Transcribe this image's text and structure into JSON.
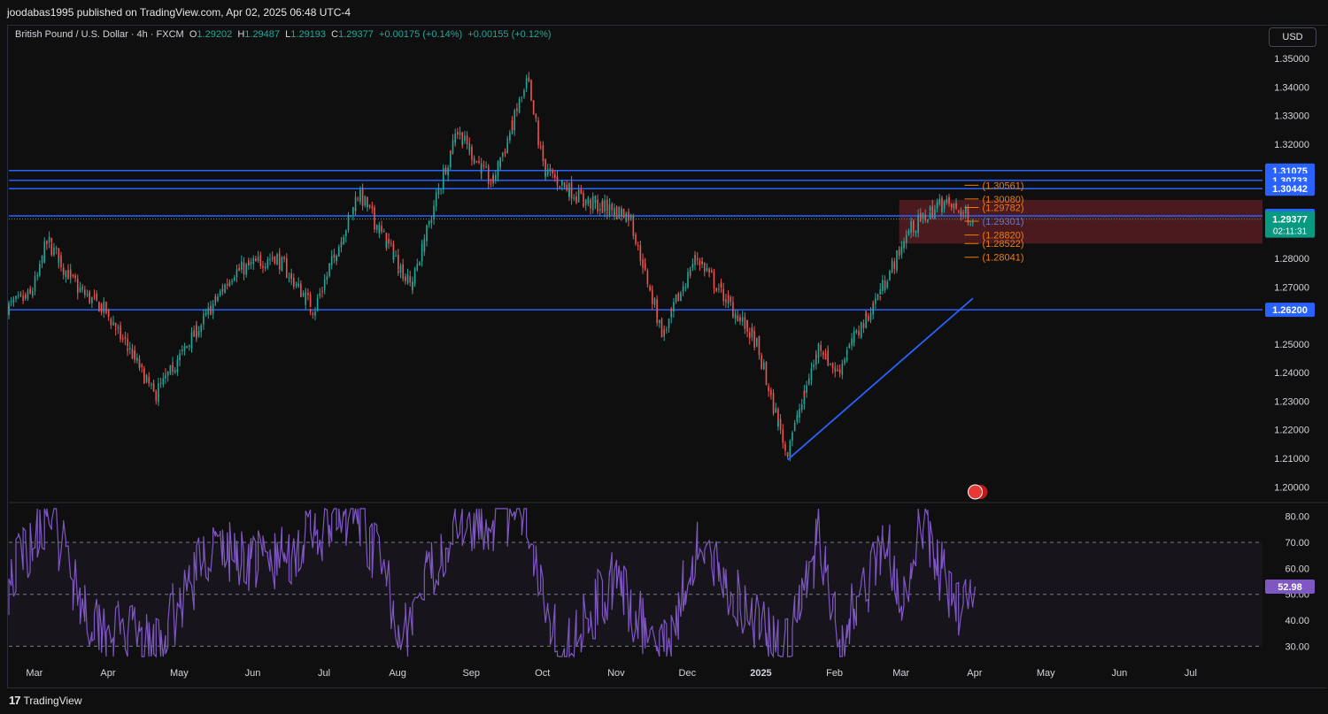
{
  "header": {
    "published_by": "joodabas1995 published on TradingView.com, Apr 02, 2025 06:48 UTC-4"
  },
  "legend": {
    "symbol": "British Pound / U.S. Dollar · 4h · FXCM",
    "o_label": "O",
    "o_value": "1.29202",
    "h_label": "H",
    "h_value": "1.29487",
    "l_label": "L",
    "l_value": "1.29193",
    "c_label": "C",
    "c_value": "1.29377",
    "change1": "+0.00175 (+0.14%)",
    "change2": "+0.00155 (+0.12%)"
  },
  "currency_button": "USD",
  "footer": {
    "brand": "TradingView",
    "logo_glyph": "17"
  },
  "colors": {
    "background": "#0f0f0f",
    "up": "#26a69a",
    "down": "#ef5350",
    "level_line": "#2962ff",
    "rsi_line": "#7e57c2",
    "zone": "#5a1d22",
    "fib": "#f57c00"
  },
  "chart_data": [
    {
      "type": "candlestick",
      "symbol": "GBPUSD",
      "timeframe": "4h",
      "yaxis_ticks": [
        "1.35000",
        "1.34000",
        "1.33000",
        "1.32000",
        "1.28000",
        "1.27000",
        "1.25000",
        "1.24000",
        "1.23000",
        "1.22000",
        "1.21000",
        "1.20000"
      ],
      "ylim": [
        1.197,
        1.3525
      ],
      "x_ticks": [
        "Mar",
        "Apr",
        "May",
        "Jun",
        "Jul",
        "Aug",
        "Sep",
        "Oct",
        "Nov",
        "Dec",
        "2025",
        "Feb",
        "Mar",
        "Apr",
        "May",
        "Jun",
        "Jul"
      ],
      "price_path": [
        {
          "date": "2024-02-20",
          "close": 1.263
        },
        {
          "date": "2024-03-01",
          "close": 1.267
        },
        {
          "date": "2024-03-08",
          "close": 1.286
        },
        {
          "date": "2024-03-20",
          "close": 1.27
        },
        {
          "date": "2024-04-01",
          "close": 1.262
        },
        {
          "date": "2024-04-12",
          "close": 1.247
        },
        {
          "date": "2024-04-22",
          "close": 1.232
        },
        {
          "date": "2024-05-10",
          "close": 1.255
        },
        {
          "date": "2024-05-25",
          "close": 1.275
        },
        {
          "date": "2024-06-12",
          "close": 1.281
        },
        {
          "date": "2024-06-28",
          "close": 1.262
        },
        {
          "date": "2024-07-17",
          "close": 1.303
        },
        {
          "date": "2024-08-08",
          "close": 1.27
        },
        {
          "date": "2024-08-27",
          "close": 1.325
        },
        {
          "date": "2024-09-11",
          "close": 1.306
        },
        {
          "date": "2024-09-26",
          "close": 1.342
        },
        {
          "date": "2024-10-03",
          "close": 1.311
        },
        {
          "date": "2024-10-20",
          "close": 1.3
        },
        {
          "date": "2024-11-08",
          "close": 1.295
        },
        {
          "date": "2024-11-22",
          "close": 1.253
        },
        {
          "date": "2024-12-06",
          "close": 1.281
        },
        {
          "date": "2024-12-31",
          "close": 1.251
        },
        {
          "date": "2025-01-13",
          "close": 1.212
        },
        {
          "date": "2025-01-27",
          "close": 1.25
        },
        {
          "date": "2025-02-03",
          "close": 1.24
        },
        {
          "date": "2025-02-20",
          "close": 1.266
        },
        {
          "date": "2025-03-06",
          "close": 1.29
        },
        {
          "date": "2025-03-20",
          "close": 1.3
        },
        {
          "date": "2025-04-02",
          "close": 1.29377
        }
      ],
      "horizontal_levels": [
        {
          "price": 1.31075,
          "label": "1.31075"
        },
        {
          "price": 1.30733,
          "label": "1.30733"
        },
        {
          "price": 1.30442,
          "label": "1.30442"
        },
        {
          "price": 1.2949,
          "label": "1.29490"
        },
        {
          "price": 1.262,
          "label": "1.26200"
        }
      ],
      "last_price": {
        "value": "1.29377",
        "countdown": "02:11:31"
      },
      "zone": {
        "from_date": "2025-03-01",
        "top": 1.3005,
        "bottom": 1.2852
      },
      "trendline": [
        {
          "date": "2025-01-13",
          "price": 1.2095
        },
        {
          "date": "2025-04-01",
          "price": 1.266
        }
      ],
      "fib_levels": [
        {
          "price": 1.30561,
          "label": "(1.30561)"
        },
        {
          "price": 1.3008,
          "label": "(1.30080)"
        },
        {
          "price": 1.29782,
          "label": "(1.29782)"
        },
        {
          "price": 1.29301,
          "label": "(1.29301)"
        },
        {
          "price": 1.2882,
          "label": "(1.28820)"
        },
        {
          "price": 1.28522,
          "label": "(1.28522)"
        },
        {
          "price": 1.28041,
          "label": "(1.28041)"
        }
      ]
    },
    {
      "type": "line",
      "indicator": "RSI",
      "yaxis_ticks": [
        "80.00",
        "70.00",
        "60.00",
        "50.00",
        "40.00",
        "30.00"
      ],
      "ylim": [
        25,
        84
      ],
      "bands": [
        30,
        50,
        70
      ],
      "current_value": "52.98",
      "path": [
        {
          "date": "2024-02-20",
          "value": 55
        },
        {
          "date": "2024-03-08",
          "value": 83
        },
        {
          "date": "2024-03-25",
          "value": 42
        },
        {
          "date": "2024-04-22",
          "value": 28
        },
        {
          "date": "2024-05-15",
          "value": 68
        },
        {
          "date": "2024-06-10",
          "value": 62
        },
        {
          "date": "2024-07-17",
          "value": 82
        },
        {
          "date": "2024-08-05",
          "value": 35
        },
        {
          "date": "2024-08-27",
          "value": 80
        },
        {
          "date": "2024-09-26",
          "value": 78
        },
        {
          "date": "2024-10-10",
          "value": 27
        },
        {
          "date": "2024-11-01",
          "value": 55
        },
        {
          "date": "2024-11-22",
          "value": 27
        },
        {
          "date": "2024-12-06",
          "value": 68
        },
        {
          "date": "2025-01-13",
          "value": 27
        },
        {
          "date": "2025-01-27",
          "value": 72
        },
        {
          "date": "2025-02-05",
          "value": 33
        },
        {
          "date": "2025-02-24",
          "value": 70
        },
        {
          "date": "2025-03-03",
          "value": 40
        },
        {
          "date": "2025-03-10",
          "value": 79
        },
        {
          "date": "2025-03-25",
          "value": 45
        },
        {
          "date": "2025-04-02",
          "value": 52.98
        }
      ]
    }
  ]
}
